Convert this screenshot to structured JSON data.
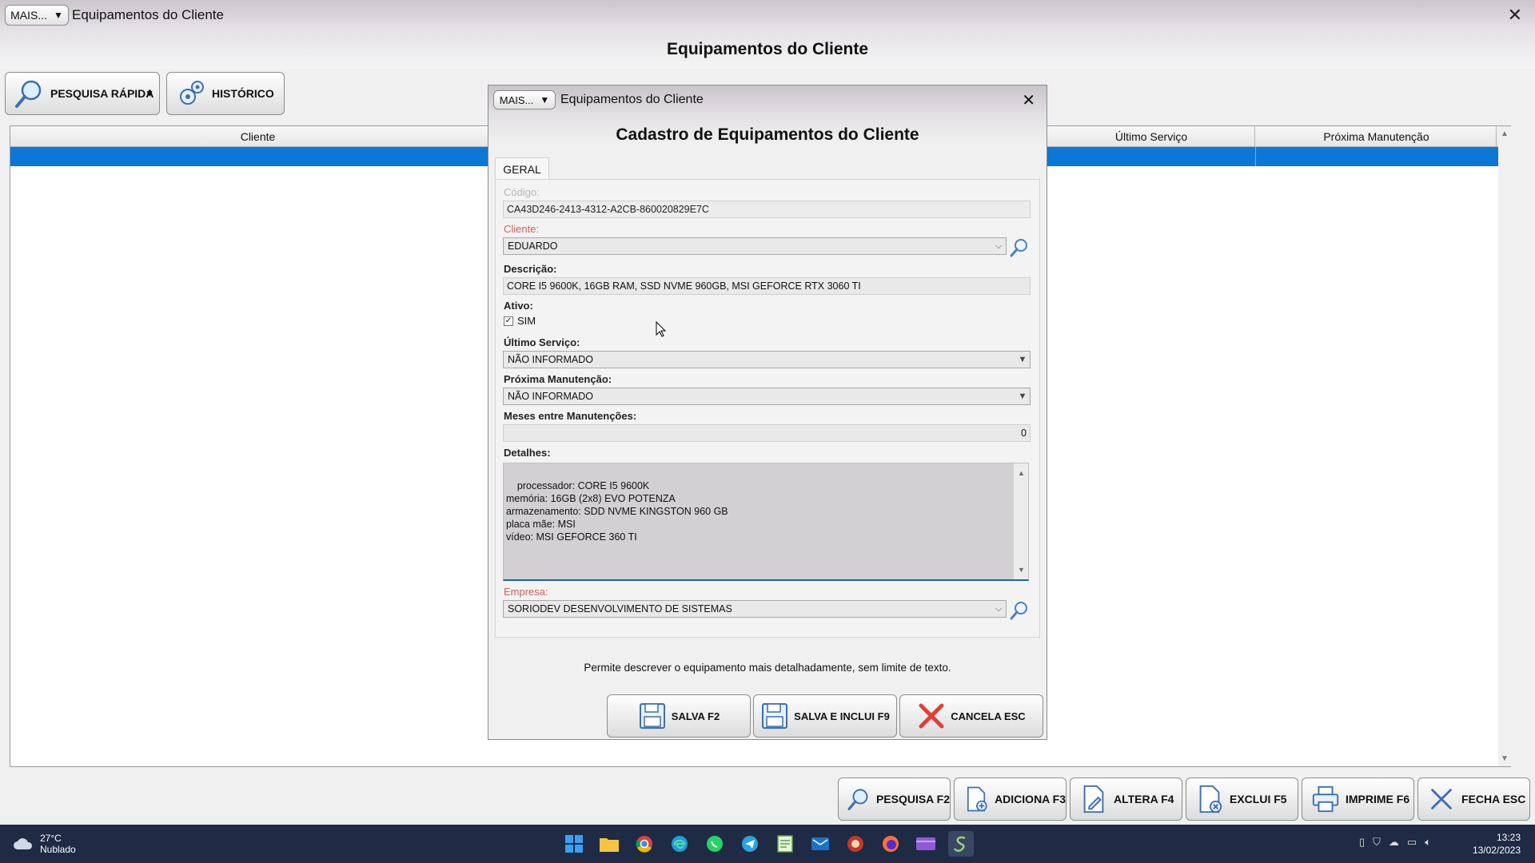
{
  "main_window": {
    "mais_label": "MAIS...",
    "title": "Equipamentos do Cliente",
    "close_glyph": "✕",
    "heading": "Equipamentos do Cliente",
    "toolbar": {
      "quick_search_label": "PESQUISA RÁPIDA",
      "history_label": "HISTÓRICO"
    },
    "grid": {
      "columns": [
        "Cliente",
        "Último Serviço",
        "Próxima Manutenção"
      ]
    },
    "bottom_buttons": {
      "search": "PESQUISA F2",
      "add": "ADICIONA F3",
      "edit": "ALTERA F4",
      "delete": "EXCLUI F5",
      "print": "IMPRIME F6",
      "close": "FECHA ESC"
    }
  },
  "dialog": {
    "mais_label": "MAIS...",
    "title": "Equipamentos do Cliente",
    "close_glyph": "✕",
    "heading": "Cadastro de Equipamentos do Cliente",
    "tab_label": "GERAL",
    "fields": {
      "codigo_label": "Código:",
      "codigo_value": "CA43D246-2413-4312-A2CB-860020829E7C",
      "cliente_label": "Cliente:",
      "cliente_value": "EDUARDO",
      "descricao_label": "Descrição:",
      "descricao_value": "CORE I5 9600K, 16GB RAM, SSD NVME 960GB, MSI GEFORCE RTX 3060 TI",
      "ativo_label": "Ativo:",
      "ativo_option": "SIM",
      "ativo_checked": true,
      "ultimo_servico_label": "Último Serviço:",
      "ultimo_servico_value": "NÃO INFORMADO",
      "proxima_manutencao_label": "Próxima Manutenção:",
      "proxima_manutencao_value": "NÃO INFORMADO",
      "meses_label": "Meses entre Manutenções:",
      "meses_value": "0",
      "detalhes_label": "Detalhes:",
      "detalhes_value": "processador: CORE I5 9600K\nmemória: 16GB (2x8) EVO POTENZA\narmazenamento: SDD NVME KINGSTON 960 GB\nplaca mãe: MSI\nvídeo: MSI GEFORCE 360 TI",
      "empresa_label": "Empresa:",
      "empresa_value": "SORIODEV DESENVOLVIMENTO DE SISTEMAS"
    },
    "hint": "Permite descrever o equipamento mais detalhadamente, sem limite de texto.",
    "buttons": {
      "save": "SALVA F2",
      "save_include": "SALVA E INCLUI F9",
      "cancel": "CANCELA ESC"
    }
  },
  "taskbar": {
    "temperature": "27°C",
    "condition": "Nublado",
    "time": "13:23",
    "date": "13/02/2023",
    "apps": [
      "start-icon",
      "file-explorer-icon",
      "chrome-icon",
      "edge-icon",
      "whatsapp-icon",
      "telegram-icon",
      "notepad-icon",
      "outlook-icon",
      "app-icon",
      "firefox-icon",
      "media-icon",
      "soriodev-icon"
    ]
  },
  "colors": {
    "selection": "#0b78d7",
    "required_label": "#d0605c",
    "taskbar": "#1f2a44"
  }
}
